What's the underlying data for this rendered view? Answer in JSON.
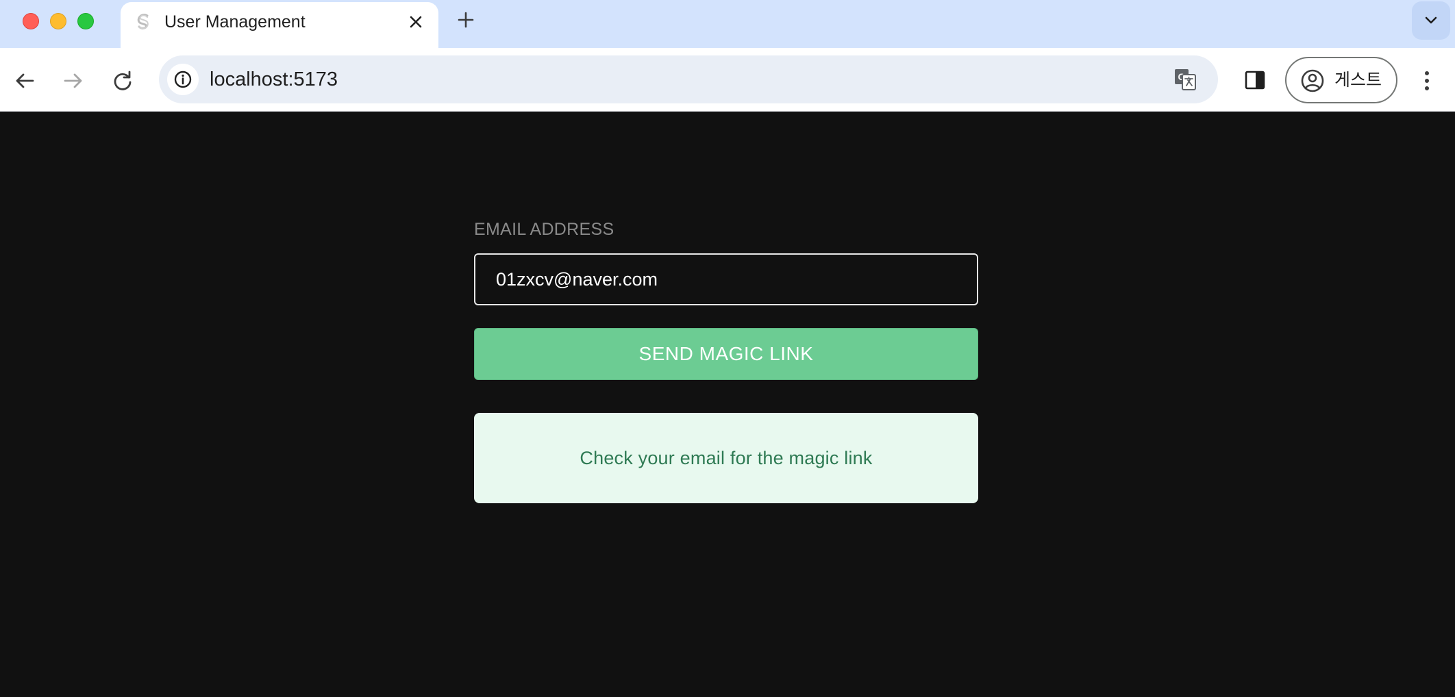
{
  "browser": {
    "tab": {
      "title": "User Management",
      "favicon": "svelte-logo-icon"
    },
    "address_bar": {
      "url": "localhost:5173"
    },
    "profile": {
      "label": "게스트"
    },
    "icons": {
      "back": "arrow-left-icon",
      "forward": "arrow-right-icon",
      "reload": "reload-icon",
      "site_info": "info-icon",
      "translate": "translate-icon",
      "side_panel": "side-panel-icon",
      "profile": "account-circle-icon",
      "menu": "kebab-menu-icon",
      "new_tab": "plus-icon",
      "tab_close": "close-icon",
      "tab_search": "chevron-down-icon"
    }
  },
  "auth_form": {
    "email_label": "EMAIL ADDRESS",
    "email_value": "01zxcv@naver.com",
    "submit_label": "SEND MAGIC LINK",
    "message": "Check your email for the magic link"
  },
  "colors": {
    "page_background": "#111111",
    "button_green": "#6ccc93",
    "message_background": "#e8f9ef",
    "message_text": "#2e7a53",
    "tabstrip": "#d3e3fd"
  }
}
